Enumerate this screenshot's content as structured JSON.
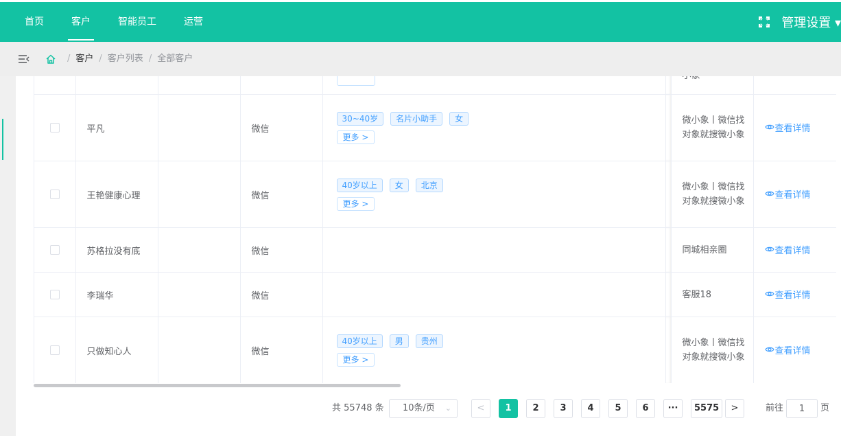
{
  "topnav": {
    "items": [
      {
        "label": "首页"
      },
      {
        "label": "客户"
      },
      {
        "label": "智能员工"
      },
      {
        "label": "运营"
      }
    ],
    "active_index": 1,
    "admin_label": "管理设置 ▾",
    "fullscreen_icon": "fullscreen-icon"
  },
  "breadcrumb": {
    "separator": "/",
    "items": [
      "客户",
      "客户列表",
      "全部客户"
    ]
  },
  "table": {
    "rows": [
      {
        "name": "",
        "remark": "",
        "source": "",
        "tags": [],
        "more": "",
        "channel": "小象",
        "action": ""
      },
      {
        "name": "平凡",
        "remark": "",
        "source": "微信",
        "tags": [
          "30~40岁",
          "名片小助手",
          "女"
        ],
        "more": "更多 >",
        "channel": "微小象丨微信找对象就搜微小象",
        "action": "查看详情"
      },
      {
        "name": "王艳健康心理",
        "remark": "",
        "source": "微信",
        "tags": [
          "40岁以上",
          "女",
          "北京"
        ],
        "more": "更多 >",
        "channel": "微小象丨微信找对象就搜微小象",
        "action": "查看详情"
      },
      {
        "name": "苏格拉没有底",
        "remark": "",
        "source": "微信",
        "tags": [],
        "more": "",
        "channel": "同城相亲圈",
        "action": "查看详情"
      },
      {
        "name": "李瑞华",
        "remark": "",
        "source": "微信",
        "tags": [],
        "more": "",
        "channel": "客服18",
        "action": "查看详情"
      },
      {
        "name": "只做知心人",
        "remark": "",
        "source": "微信",
        "tags": [
          "40岁以上",
          "男",
          "贵州"
        ],
        "more": "更多 >",
        "channel": "微小象丨微信找对象就搜微小象",
        "action": "查看详情"
      }
    ]
  },
  "pagination": {
    "total_text": "共 55748 条",
    "page_size": "10条/页",
    "pages": [
      "1",
      "2",
      "3",
      "4",
      "5",
      "6",
      "···",
      "5575"
    ],
    "current_page": "1",
    "jump_label": "前往",
    "jump_value": "1",
    "jump_suffix": "页"
  },
  "colors": {
    "brand": "#13c2a3",
    "link": "#409eff"
  }
}
